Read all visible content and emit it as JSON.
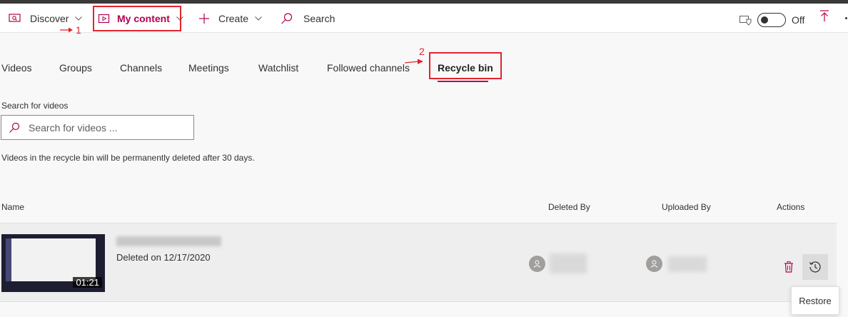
{
  "nav": {
    "discover": "Discover",
    "my_content": "My content",
    "create": "Create",
    "search": "Search",
    "toggle_state": "Off"
  },
  "annotations": {
    "one": "1",
    "two": "2"
  },
  "tabs": [
    {
      "label": "Videos"
    },
    {
      "label": "Groups"
    },
    {
      "label": "Channels"
    },
    {
      "label": "Meetings"
    },
    {
      "label": "Watchlist"
    },
    {
      "label": "Followed channels"
    },
    {
      "label": "Recycle bin",
      "active": true
    }
  ],
  "search": {
    "label": "Search for videos",
    "placeholder": "Search for videos ..."
  },
  "info_text": "Videos in the recycle bin will be permanently deleted after 30 days.",
  "table": {
    "columns": [
      "Name",
      "Deleted By",
      "Uploaded By",
      "Actions"
    ],
    "rows": [
      {
        "duration": "01:21",
        "deleted_on": "Deleted on 12/17/2020"
      }
    ]
  },
  "tooltip": "Restore",
  "colors": {
    "accent": "#b4004e",
    "annotation": "#e0242f"
  }
}
